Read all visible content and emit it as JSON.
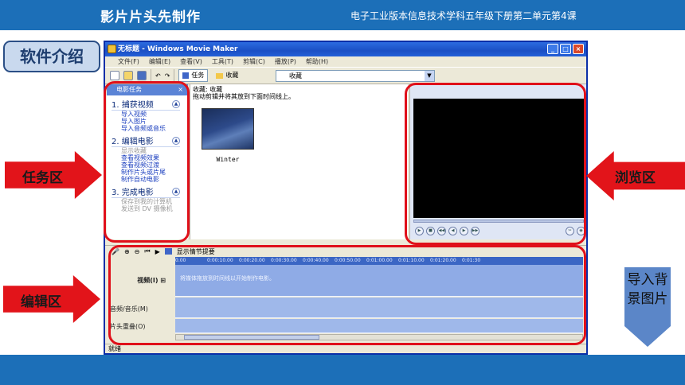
{
  "header": {
    "title": "影片片头先制作",
    "subtitle": "电子工业版本信息技术学科五年级下册第二单元第4课"
  },
  "section_label": "软件介绍",
  "callouts": {
    "task_area": "任务区",
    "browse_area": "浏览区",
    "edit_area": "编辑区",
    "import_bg": "导入背景图片"
  },
  "window": {
    "title": "无标题 - Windows Movie Maker",
    "menu": [
      "文件(F)",
      "编辑(E)",
      "查看(V)",
      "工具(T)",
      "剪辑(C)",
      "播放(P)",
      "帮助(H)"
    ],
    "toolbar": {
      "tasks_label": "任务",
      "collections_label": "收藏",
      "collections_select": "收藏"
    },
    "tasks_pane": {
      "header": "电影任务",
      "sections": [
        {
          "title": "1. 捕获视频",
          "links": [
            "导入视频",
            "导入图片",
            "导入音频或音乐"
          ],
          "dim": [
            false,
            false,
            false
          ]
        },
        {
          "title": "2. 编辑电影",
          "links": [
            "显示收藏",
            "查看视频效果",
            "查看视频过渡",
            "制作片头或片尾",
            "制作自动电影"
          ],
          "dim": [
            true,
            false,
            false,
            false,
            false
          ]
        },
        {
          "title": "3. 完成电影",
          "links": [
            "保存到我的计算机",
            "发送到 DV 摄像机"
          ],
          "dim": [
            true,
            true
          ]
        }
      ]
    },
    "collection_pane": {
      "title": "收藏: 收藏",
      "hint": "拖动剪辑并将其放到下面时间线上。",
      "clip_name": "Winter"
    },
    "timeline": {
      "show_storyboard": "显示情节提要",
      "ruler": [
        "0.00",
        "0:00:10.00",
        "0:00:20.00",
        "0:00:30.00",
        "0:00:40.00",
        "0:00:50.00",
        "0:01:00.00",
        "0:01:10.00",
        "0:01:20.00",
        "0:01:30"
      ],
      "video_label": "视频(I)",
      "audio_label": "音频/音乐(M)",
      "overlay_label": "片头重叠(O)",
      "video_hint": "将媒体拖放到时间线以开始制作电影。"
    },
    "status": "就绪"
  }
}
